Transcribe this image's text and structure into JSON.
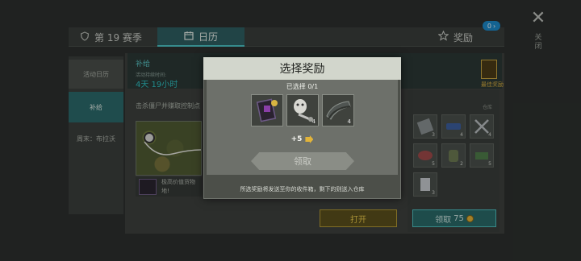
{
  "header": {
    "season_tab": "第 19 赛季",
    "calendar_tab": "日历",
    "reward_tab": "奖励",
    "reward_badge": "0",
    "close_vertical": "关闭"
  },
  "sidebar": {
    "items": [
      {
        "label": "活动日历"
      },
      {
        "label": "补给"
      },
      {
        "label": "周末：布拉沃"
      }
    ]
  },
  "event": {
    "title": "补给",
    "duration_label": "活动持续时间:",
    "duration_value": "4天 19小时",
    "description": "击杀僵尸并赚取控制点",
    "item_desc": "极高价值货物\n地!",
    "open_button": "打开",
    "final_reward_label": "最佳奖励"
  },
  "right_panel": {
    "label": "仓库",
    "slots": [
      {
        "icon": "metal-plate-icon",
        "count": "3"
      },
      {
        "icon": "blue-part-icon",
        "count": "4"
      },
      {
        "icon": "wrench-icon",
        "count": "4"
      },
      {
        "icon": "meat-icon",
        "count": "5"
      },
      {
        "icon": "backpack-icon",
        "count": "2"
      },
      {
        "icon": "green-board-icon",
        "count": "5"
      },
      {
        "icon": "paper-icon",
        "count": "3"
      }
    ],
    "claim_label": "领取",
    "claim_cost": "75"
  },
  "dialog": {
    "title": "选择奖励",
    "selected_label": "已选择 0/1",
    "items": [
      {
        "icon": "phone-case-icon",
        "count": ""
      },
      {
        "icon": "mask-key-icon",
        "count": "4"
      },
      {
        "icon": "steel-sheet-icon",
        "count": "4"
      }
    ],
    "plus_value": "+5",
    "claim_label": "领取",
    "note": "所选奖励将发送至你的收件箱，剩下的则送入仓库"
  },
  "colors": {
    "accent_teal": "#4cc3c4",
    "gold": "#e2b43a",
    "dialog_header": "#d2d6cc"
  }
}
